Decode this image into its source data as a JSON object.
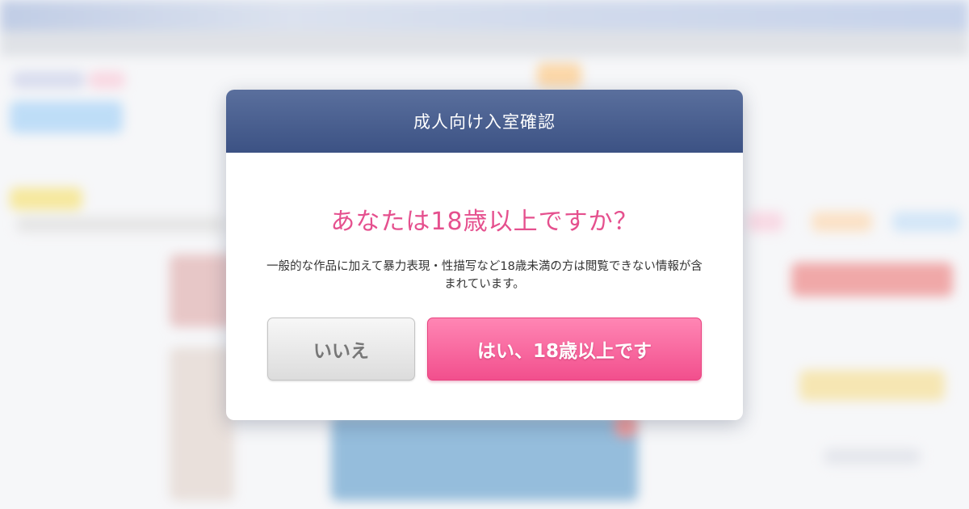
{
  "modal": {
    "title": "成人向け入室確認",
    "question": "あなたは18歳以上ですか？",
    "description": "一般的な作品に加えて暴力表現・性描写など18歳未満の方は閲覧できない情報が含まれています。",
    "no_label": "いいえ",
    "yes_label": "はい、18歳以上です"
  },
  "colors": {
    "header_bg": "#445a8c",
    "question_text": "#e5508e",
    "yes_button": "#f5619a",
    "no_button": "#e6e6e6"
  }
}
